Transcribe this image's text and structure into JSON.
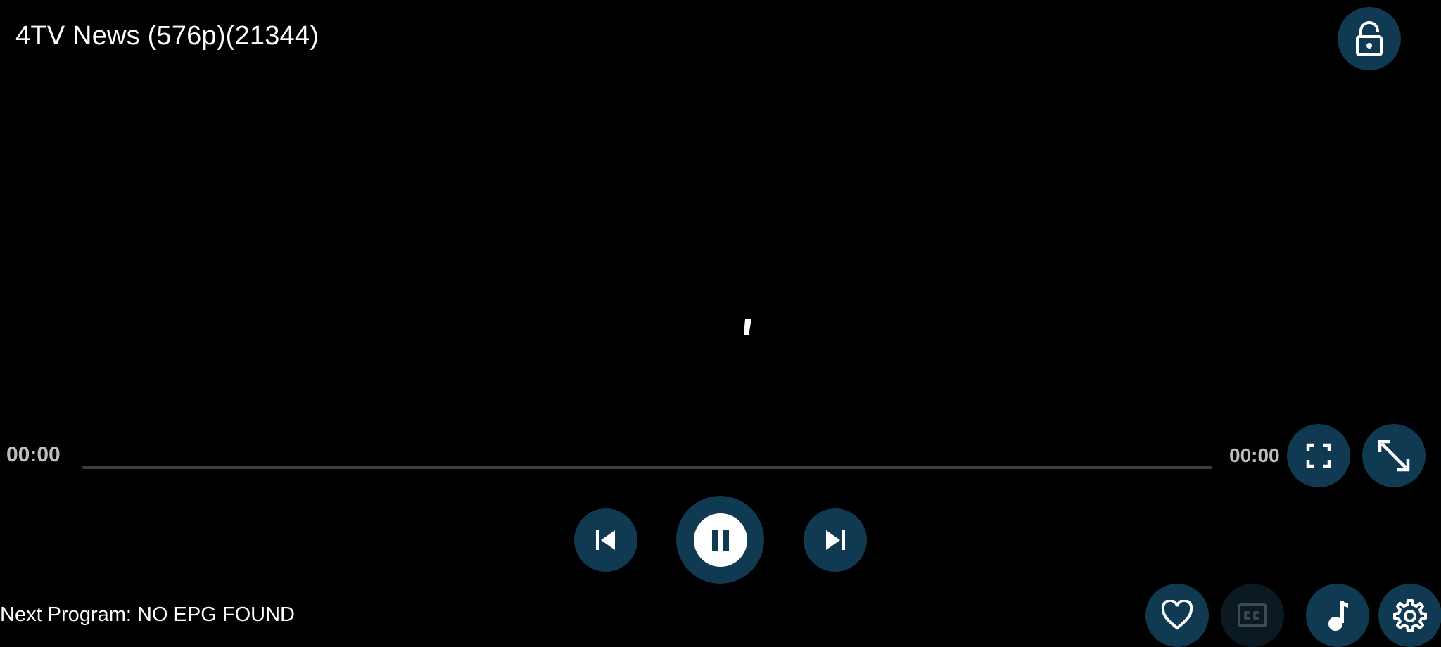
{
  "player": {
    "title": "4TV News (576p)(21344)",
    "current_time": "00:00",
    "total_time": "00:00",
    "progress": 0,
    "next_program_label": "Next Program: NO EPG FOUND"
  },
  "controls": {
    "lock": "lock-open-icon",
    "aspect": "fullscreen-icon",
    "resize": "expand-arrows-icon",
    "previous": "skip-previous-icon",
    "play_pause": "pause-icon",
    "next": "skip-next-icon",
    "favorite": "heart-icon",
    "captions": "closed-captions-icon",
    "captions_enabled": false,
    "audio": "music-note-icon",
    "settings": "gear-icon"
  },
  "colors": {
    "background": "#000000",
    "button_bg": "#103a52",
    "button_disabled_bg": "#0b1a22",
    "text": "#ffffff",
    "time_text": "#bdbdbd",
    "seek_track": "#3d3d3d"
  }
}
